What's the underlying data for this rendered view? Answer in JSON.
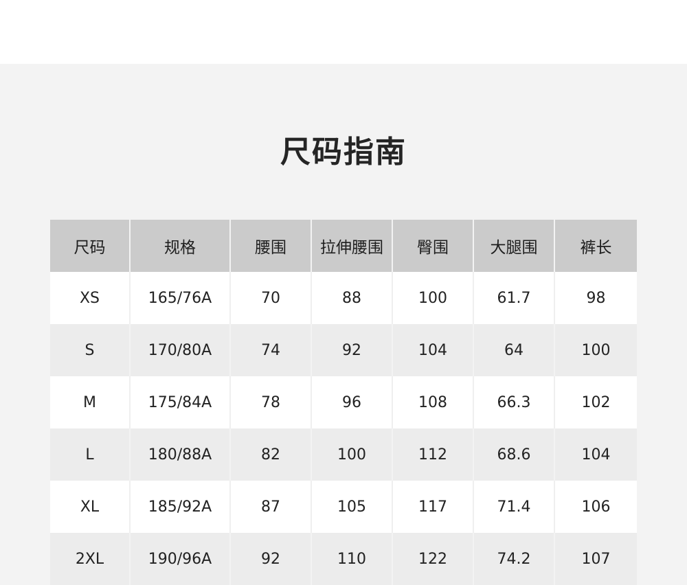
{
  "title": "尺码指南",
  "table": {
    "headers": [
      "尺码",
      "规格",
      "腰围",
      "拉伸腰围",
      "臀围",
      "大腿围",
      "裤长"
    ],
    "rows": [
      [
        "XS",
        "165/76A",
        "70",
        "88",
        "100",
        "61.7",
        "98"
      ],
      [
        "S",
        "170/80A",
        "74",
        "92",
        "104",
        "64",
        "100"
      ],
      [
        "M",
        "175/84A",
        "78",
        "96",
        "108",
        "66.3",
        "102"
      ],
      [
        "L",
        "180/88A",
        "82",
        "100",
        "112",
        "68.6",
        "104"
      ],
      [
        "XL",
        "185/92A",
        "87",
        "105",
        "117",
        "71.4",
        "106"
      ],
      [
        "2XL",
        "190/96A",
        "92",
        "110",
        "122",
        "74.2",
        "107"
      ]
    ]
  }
}
